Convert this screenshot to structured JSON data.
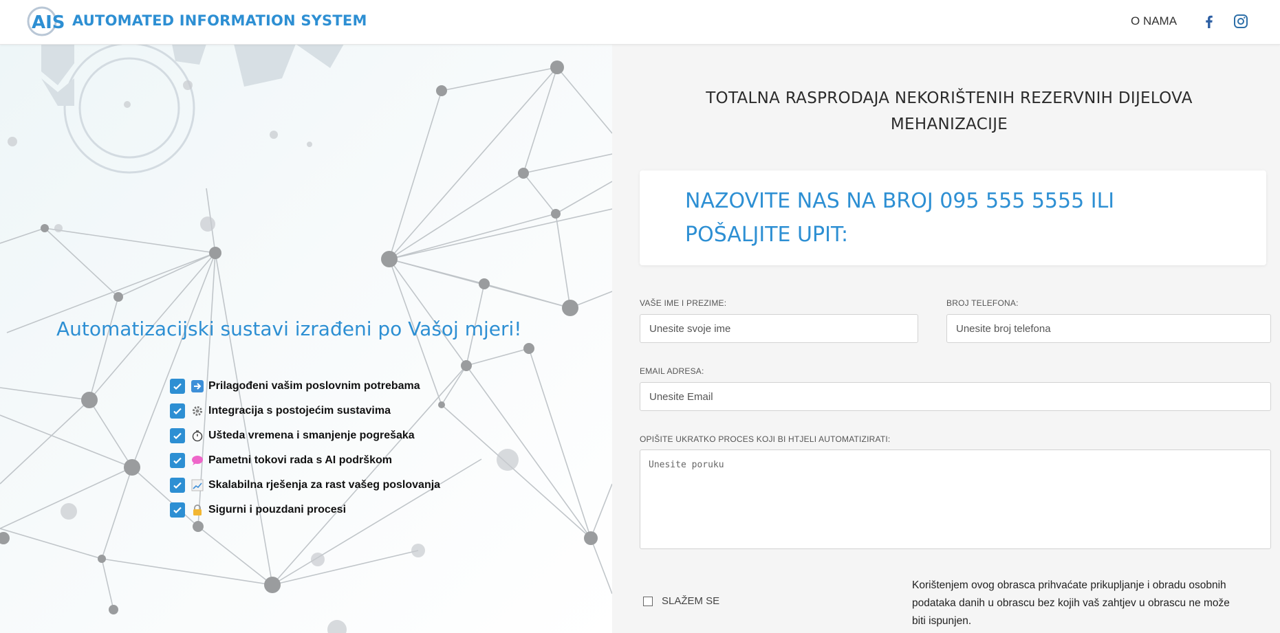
{
  "header": {
    "logo_text": "AUTOMATED INFORMATION SYSTEM",
    "nav_about": "O NAMA",
    "social_icons": [
      "facebook-icon",
      "instagram-icon"
    ],
    "brand_color": "#2d8fd3"
  },
  "hero": {
    "headline": "Automatizacijski sustavi izrađeni po Vašoj mjeri!",
    "features": [
      {
        "icon": "arrow-right-icon",
        "text": "Prilagođeni vašim poslovnim potrebama"
      },
      {
        "icon": "gear-icon",
        "text": "Integracija s postojećim sustavima"
      },
      {
        "icon": "stopwatch-icon",
        "text": "Ušteda vremena i smanjenje pogrešaka"
      },
      {
        "icon": "speech-bubble-icon",
        "text": "Pametni tokovi rada s AI podrškom"
      },
      {
        "icon": "chart-icon",
        "text": "Skalabilna rješenja za rast vašeg poslovanja"
      },
      {
        "icon": "lock-icon",
        "text": "Sigurni i pouzdani procesi"
      }
    ]
  },
  "form_section": {
    "title": "TOTALNA RASPRODAJA NEKORIŠTENIH REZERVNIH DIJELOVA MEHANIZACIJE",
    "cta": "NAZOVITE NAS NA BROJ 095 555 5555 ILI POŠALJITE UPIT:",
    "fields": {
      "name": {
        "label": "VAŠE IME I PREZIME:",
        "placeholder": "Unesite svoje ime",
        "value": ""
      },
      "phone": {
        "label": "BROJ TELEFONA:",
        "placeholder": "Unesite broj telefona",
        "value": ""
      },
      "email": {
        "label": "EMAIL ADRESA:",
        "placeholder": "Unesite Email",
        "value": ""
      },
      "message": {
        "label": "OPIŠITE UKRATKO PROCES KOJI BI HTJELI AUTOMATIZIRATI:",
        "placeholder": "Unesite poruku",
        "value": ""
      }
    },
    "agree_label": "SLAŽEM SE",
    "consent_text": "Korištenjem ovog obrasca prihvaćate prikupljanje i obradu osobnih podataka danih u obrascu bez kojih vaš zahtjev u obrascu ne može biti ispunjen."
  }
}
